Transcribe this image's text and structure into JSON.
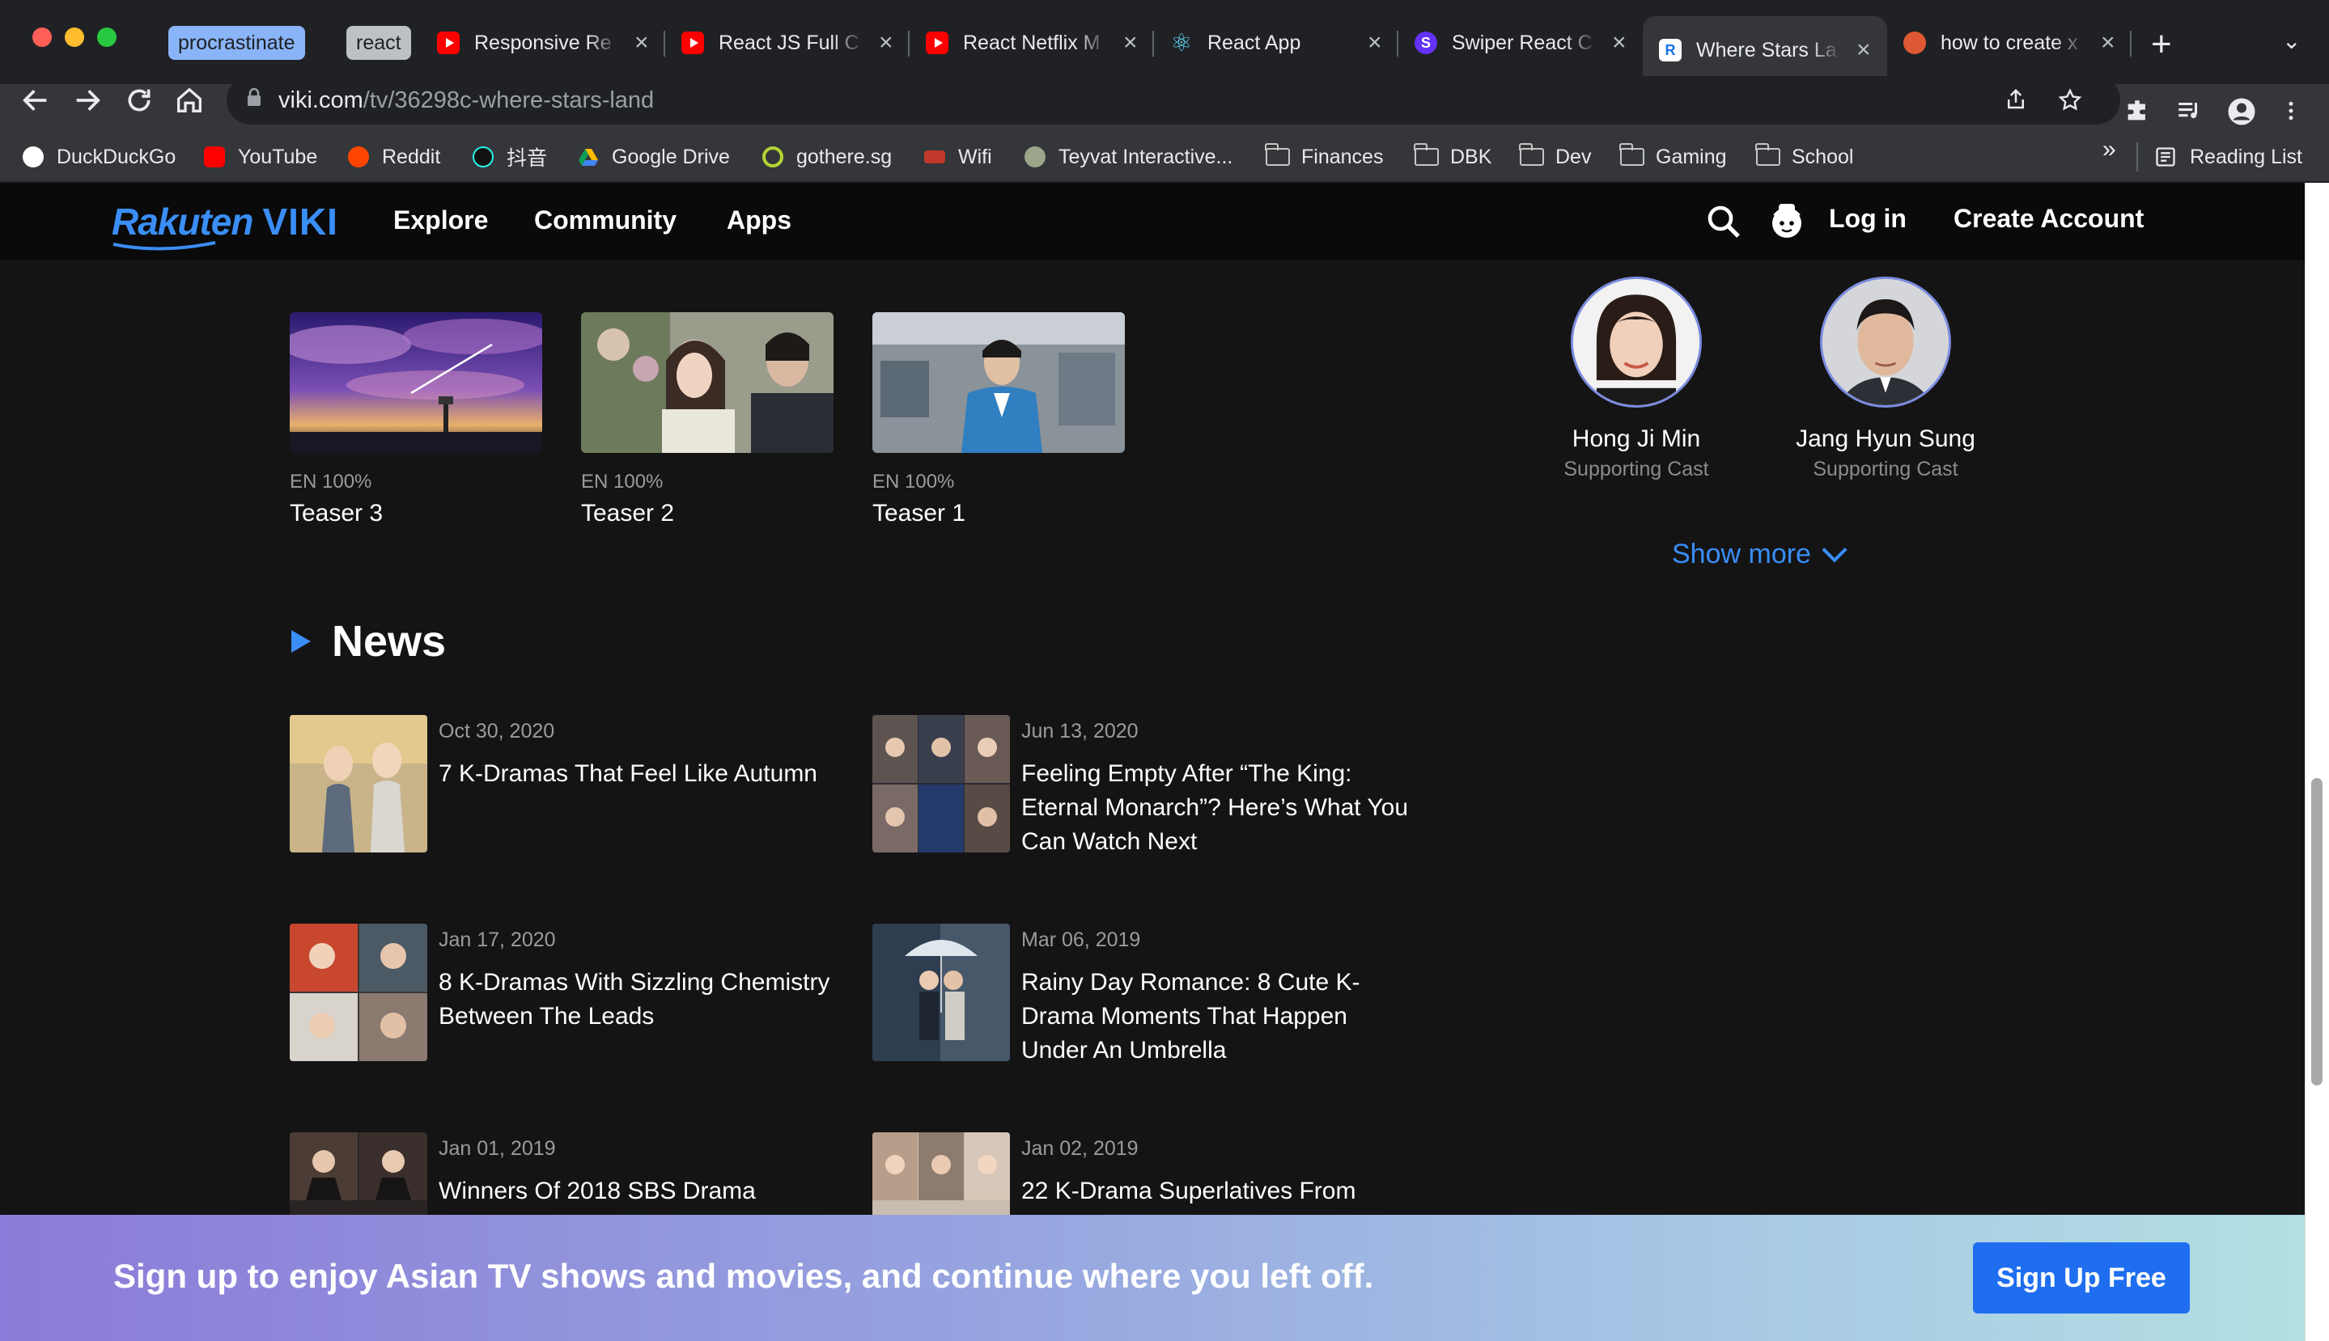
{
  "browser": {
    "tab_groups": [
      "procrastinate",
      "react"
    ],
    "tabs": [
      {
        "title": "Responsive Re",
        "favicon": "youtube-icon"
      },
      {
        "title": "React JS Full C",
        "favicon": "youtube-icon"
      },
      {
        "title": "React Netflix M",
        "favicon": "youtube-icon"
      },
      {
        "title": "React App",
        "favicon": "react-icon"
      },
      {
        "title": "Swiper React C",
        "favicon": "swiper-icon"
      },
      {
        "title": "Where Stars La",
        "favicon": "viki-icon",
        "active": true
      },
      {
        "title": "how to create x",
        "favicon": "duckduckgo-icon"
      }
    ],
    "favicon_letters": {
      "swiper": "S",
      "viki": "R"
    },
    "url_host": "viki.com",
    "url_path": "/tv/36298c-where-stars-land",
    "bookmarks": [
      {
        "label": "DuckDuckGo",
        "icon": "duckduckgo-icon"
      },
      {
        "label": "YouTube",
        "icon": "youtube-icon"
      },
      {
        "label": "Reddit",
        "icon": "reddit-icon"
      },
      {
        "label": "抖音",
        "icon": "tiktok-icon"
      },
      {
        "label": "Google Drive",
        "icon": "google-drive-icon"
      },
      {
        "label": "gothere.sg",
        "icon": "gothere-icon"
      },
      {
        "label": "Wifi",
        "icon": "wifi-icon"
      },
      {
        "label": "Teyvat Interactive...",
        "icon": "teyvat-icon"
      },
      {
        "label": "Finances",
        "icon": "folder-icon"
      },
      {
        "label": "DBK",
        "icon": "folder-icon"
      },
      {
        "label": "Dev",
        "icon": "folder-icon"
      },
      {
        "label": "Gaming",
        "icon": "folder-icon"
      },
      {
        "label": "School",
        "icon": "folder-icon"
      }
    ],
    "bookmarks_overflow": "»",
    "reading_list": "Reading List"
  },
  "site": {
    "logo_rakuten": "Rakuten",
    "logo_viki": "VIKI",
    "nav": [
      "Explore",
      "Community",
      "Apps"
    ],
    "login": "Log in",
    "create_account": "Create Account",
    "brand_color": "#3a8ef6"
  },
  "clips": [
    {
      "subtitle": "EN 100%",
      "title": "Teaser 3"
    },
    {
      "subtitle": "EN 100%",
      "title": "Teaser 2"
    },
    {
      "subtitle": "EN 100%",
      "title": "Teaser 1"
    }
  ],
  "cast": [
    {
      "name": "Hong Ji Min",
      "role": "Supporting Cast"
    },
    {
      "name": "Jang Hyun Sung",
      "role": "Supporting Cast"
    }
  ],
  "show_more": "Show more",
  "news": {
    "heading": "News",
    "items": [
      {
        "date": "Oct 30, 2020",
        "title": "7 K-Dramas That Feel Like Autumn"
      },
      {
        "date": "Jun 13, 2020",
        "title": "Feeling Empty After “The King: Eternal Monarch”? Here’s What You Can Watch Next"
      },
      {
        "date": "Jan 17, 2020",
        "title": "8 K-Dramas With Sizzling Chemistry Between The Leads"
      },
      {
        "date": "Mar 06, 2019",
        "title": "Rainy Day Romance: 8 Cute K-Drama Moments That Happen Under An Umbrella"
      },
      {
        "date": "Jan 01, 2019",
        "title": "Winners Of 2018 SBS Drama"
      },
      {
        "date": "Jan 02, 2019",
        "title": "22 K-Drama Superlatives From"
      }
    ]
  },
  "banner": {
    "text": "Sign up to enjoy Asian TV shows and movies, and continue where you left off.",
    "button": "Sign Up Free"
  }
}
